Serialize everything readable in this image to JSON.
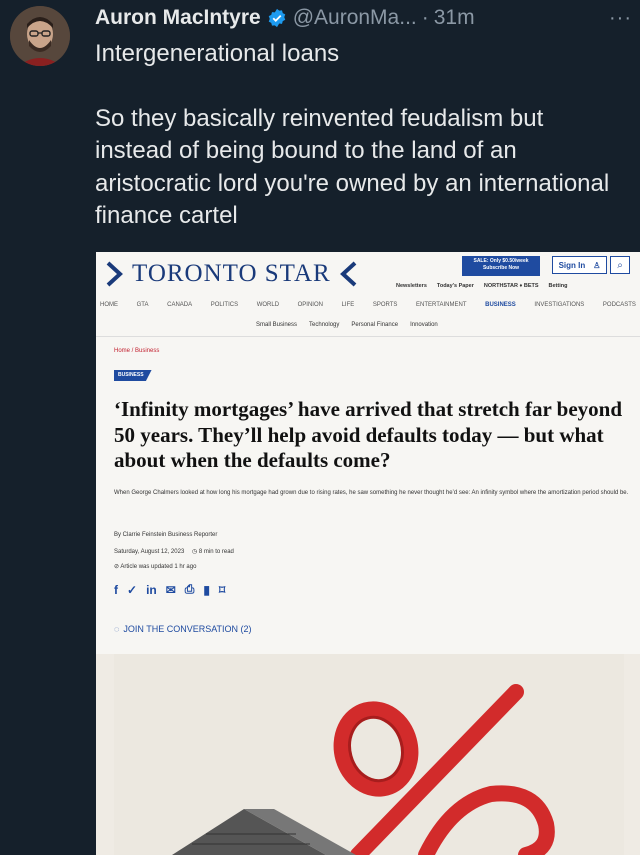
{
  "tweet": {
    "author_name": "Auron MacIntyre",
    "handle": "@AuronMa...",
    "separator": "·",
    "time": "31m",
    "more": "···",
    "text_line1": "Intergenerational loans",
    "text_body": "So they basically reinvented feudalism but instead of being bound to the land of an aristocratic lord you're owned by an international finance cartel",
    "verified_color": "#1d9bf0"
  },
  "article": {
    "brand": "TORONTO STAR",
    "subscribe_badge": "SALE: Only $0.50/week\nSubscribe Now",
    "signin": "Sign In",
    "topnav": [
      "Newsletters",
      "Today's Paper",
      "NORTHSTAR ♦ BETS",
      "Betting"
    ],
    "sections": [
      "HOME",
      "GTA",
      "CANADA",
      "POLITICS",
      "WORLD",
      "OPINION",
      "LIFE",
      "SPORTS",
      "ENTERTAINMENT",
      "BUSINESS",
      "INVESTIGATIONS",
      "PODCASTS"
    ],
    "subsections": [
      "Small Business",
      "Technology",
      "Personal Finance",
      "Innovation"
    ],
    "breadcrumb": "Home / Business",
    "section_tag": "BUSINESS",
    "headline": "‘Infinity mortgages’ have arrived that stretch far beyond 50 years. They’ll help avoid defaults today — but what about when the defaults come?",
    "dek": "When George Chalmers looked at how long his mortgage had grown due to rising rates, he saw something he never thought he’d see: An infinity symbol where the amortization period should be.",
    "byline": "By Clarrie Feinstein Business Reporter",
    "date": "Saturday, August 12, 2023",
    "read_time": "8 min to read",
    "updated": "Article was updated 1 hr ago",
    "join": "JOIN THE CONVERSATION (2)",
    "brand_color": "#1f4ba0",
    "accent_red": "#c21f2e"
  }
}
